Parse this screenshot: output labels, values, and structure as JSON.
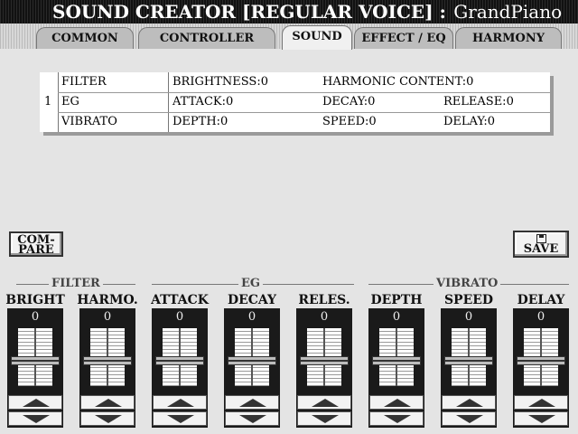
{
  "header": {
    "title_main": "SOUND CREATOR [REGULAR VOICE] :",
    "voice_name": "GrandPiano"
  },
  "tabs": [
    {
      "label": "COMMON",
      "active": false
    },
    {
      "label": "CONTROLLER",
      "active": false
    },
    {
      "label": "SOUND",
      "active": true
    },
    {
      "label": "EFFECT / EQ",
      "active": false
    },
    {
      "label": "HARMONY",
      "active": false
    }
  ],
  "param_table": {
    "row_number": "1",
    "rows": [
      {
        "name": "FILTER",
        "p1": "BRIGHTNESS:0",
        "p2": "HARMONIC CONTENT:0",
        "p3": ""
      },
      {
        "name": "EG",
        "p1": "ATTACK:0",
        "p2": "DECAY:0",
        "p3": "RELEASE:0"
      },
      {
        "name": "VIBRATO",
        "p1": "DEPTH:0",
        "p2": "SPEED:0",
        "p3": "DELAY:0"
      }
    ]
  },
  "buttons": {
    "compare_line1": "COM-",
    "compare_line2": "PARE",
    "save": "SAVE"
  },
  "groups": {
    "filter": "FILTER",
    "eg": "EG",
    "vibrato": "VIBRATO"
  },
  "sliders": [
    {
      "label": "BRIGHT",
      "value": "0"
    },
    {
      "label": "HARMO.",
      "value": "0"
    },
    {
      "label": "ATTACK",
      "value": "0"
    },
    {
      "label": "DECAY",
      "value": "0"
    },
    {
      "label": "RELES.",
      "value": "0"
    },
    {
      "label": "DEPTH",
      "value": "0"
    },
    {
      "label": "SPEED",
      "value": "0"
    },
    {
      "label": "DELAY",
      "value": "0"
    }
  ],
  "icons": {
    "up": "triangle-up-icon",
    "down": "triangle-down-icon",
    "save": "floppy-disk-icon"
  }
}
